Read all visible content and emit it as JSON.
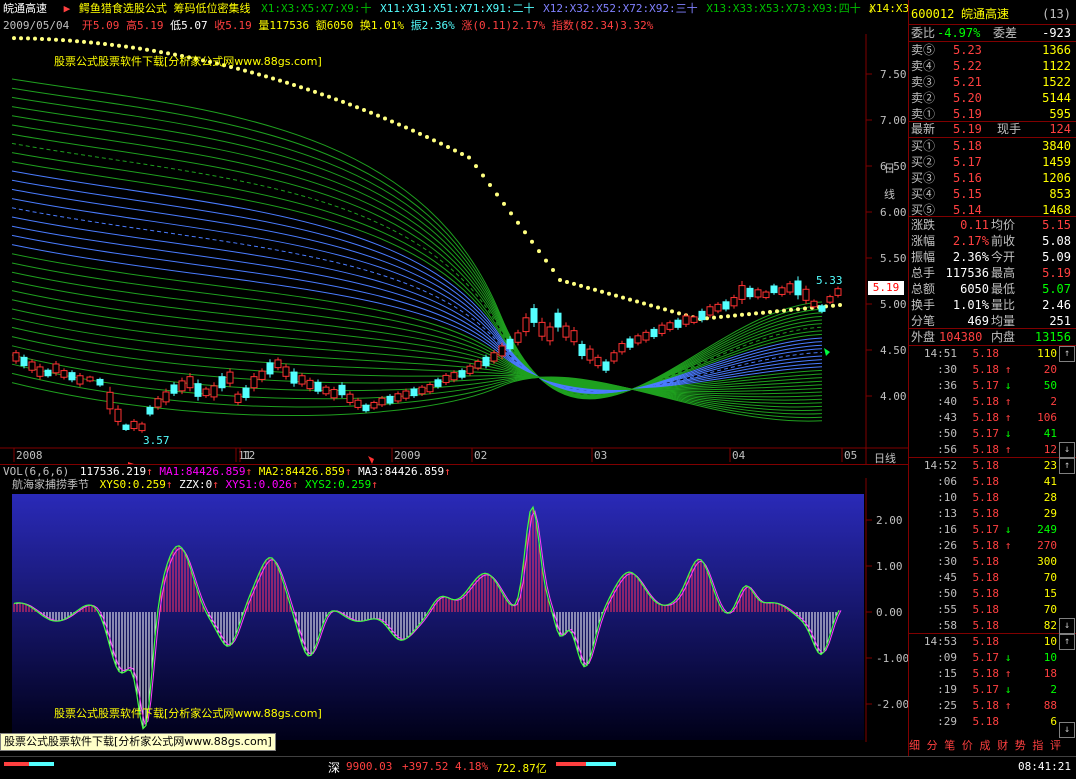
{
  "title_bar": {
    "stock_name": "皖通高速",
    "formula_label": "鳄鱼猎食选股公式 筹码低位密集线",
    "ma_labels": [
      "X1:X3:X5:X7:X9:十",
      "X11:X31:X51:X71:X91:二十",
      "X12:X32:X52:X72:X92:三十",
      "X13:X33:X53:X73:X93:四十",
      "X14:X3"
    ]
  },
  "quote_line": {
    "date": "2009/05/04",
    "open_label": "开",
    "open": "5.09",
    "high_label": "高",
    "high": "5.19",
    "low_label": "低",
    "low": "5.07",
    "close_label": "收",
    "close": "5.19",
    "vol_label": "量",
    "vol": "117536",
    "amount_label": "额",
    "amount": "6050",
    "turnover_label": "换",
    "turnover": "1.01%",
    "amplitude_label": "振",
    "amplitude": "2.36%",
    "change_label": "涨",
    "change": "(0.11)2.17%",
    "index_label": "指数",
    "index": "(82.34)3.32%"
  },
  "watermark_text": "股票公式股票软件下载[分析家公式网www.88gs.com]",
  "main_axis": {
    "ticks": [
      "7.50",
      "7.00",
      "6.50",
      "6.00",
      "5.50",
      "5.00",
      "4.50",
      "4.00"
    ],
    "current_price_tag": "5.19",
    "high_marker": "5.33",
    "low_marker": "3.57"
  },
  "date_axis": {
    "labels": [
      "2008",
      "11",
      "12",
      "2009",
      "02",
      "03",
      "04",
      "05"
    ],
    "period_button": "日线"
  },
  "side_tabs": [
    "日",
    "线"
  ],
  "vol_line": {
    "title": "VOL(6,6,6)",
    "vol": "117536.219",
    "ma1_label": "MA1:",
    "ma1": "84426.859",
    "ma2_label": "MA2:",
    "ma2": "84426.859",
    "ma3_label": "MA3:",
    "ma3": "84426.859"
  },
  "ind_line": {
    "title": "航海家捕捞季节",
    "xys0": "XYS0:0.259",
    "zzx": "ZZX:0",
    "xys1": "XYS1:0.026",
    "xys2": "XYS2:0.259"
  },
  "ind_axis": {
    "ticks": [
      "2.00",
      "1.00",
      "0.00",
      "-1.00",
      "-2.00"
    ]
  },
  "colors": {
    "bg": "#000000",
    "up": "#ff3232",
    "down": "#54ffff",
    "panel_line": "#800000",
    "ind_bg_top": "#2a2ab0",
    "ind_bg_bottom": "#000010",
    "green_line": "#00c000",
    "blue_line": "#4080ff",
    "sar_dot": "#ffff80"
  },
  "right_panel": {
    "code": "600012",
    "name": "皖通高速",
    "flag": "(13)",
    "weibi_label": "委比",
    "weibi": "-4.97%",
    "weicha_label": "委差",
    "weicha": "-923",
    "sells": [
      {
        "label": "卖⑤",
        "price": "5.23",
        "vol": "1366"
      },
      {
        "label": "卖④",
        "price": "5.22",
        "vol": "1122"
      },
      {
        "label": "卖③",
        "price": "5.21",
        "vol": "1522"
      },
      {
        "label": "卖②",
        "price": "5.20",
        "vol": "5144"
      },
      {
        "label": "卖①",
        "price": "5.19",
        "vol": "595"
      }
    ],
    "last_label": "最新",
    "last": "5.19",
    "xianshou_label": "现手",
    "xianshou": "124",
    "buys": [
      {
        "label": "买①",
        "price": "5.18",
        "vol": "3840"
      },
      {
        "label": "买②",
        "price": "5.17",
        "vol": "1459"
      },
      {
        "label": "买③",
        "price": "5.16",
        "vol": "1206"
      },
      {
        "label": "买④",
        "price": "5.15",
        "vol": "853"
      },
      {
        "label": "买⑤",
        "price": "5.14",
        "vol": "1468"
      }
    ],
    "stats": [
      {
        "l1": "涨跌",
        "v1": "0.11",
        "l2": "均价",
        "v2": "5.15"
      },
      {
        "l1": "涨幅",
        "v1": "2.17%",
        "l2": "前收",
        "v2": "5.08"
      },
      {
        "l1": "振幅",
        "v1": "2.36%",
        "l2": "今开",
        "v2": "5.09"
      },
      {
        "l1": "总手",
        "v1": "117536",
        "l2": "最高",
        "v2": "5.19"
      },
      {
        "l1": "总额",
        "v1": "6050",
        "l2": "最低",
        "v2": "5.07"
      },
      {
        "l1": "换手",
        "v1": "1.01%",
        "l2": "量比",
        "v2": "2.46"
      },
      {
        "l1": "分笔",
        "v1": "469",
        "l2": "均量",
        "v2": "251"
      }
    ],
    "outer_label": "外盘",
    "outer": "104380",
    "inner_label": "内盘",
    "inner": "13156",
    "ticks_block1": [
      {
        "t": "14:51",
        "p": "5.18",
        "d": "",
        "v": "110"
      },
      {
        "t": ":30",
        "p": "5.18",
        "d": "↑",
        "v": "20"
      },
      {
        "t": ":36",
        "p": "5.17",
        "d": "↓",
        "v": "50"
      },
      {
        "t": ":40",
        "p": "5.18",
        "d": "↑",
        "v": "2"
      },
      {
        "t": ":43",
        "p": "5.18",
        "d": "↑",
        "v": "106"
      },
      {
        "t": ":50",
        "p": "5.17",
        "d": "↓",
        "v": "41"
      },
      {
        "t": ":56",
        "p": "5.18",
        "d": "↑",
        "v": "12"
      }
    ],
    "ticks_block2": [
      {
        "t": "14:52",
        "p": "5.18",
        "d": "",
        "v": "23"
      },
      {
        "t": ":06",
        "p": "5.18",
        "d": "",
        "v": "41"
      },
      {
        "t": ":10",
        "p": "5.18",
        "d": "",
        "v": "28"
      },
      {
        "t": ":13",
        "p": "5.18",
        "d": "",
        "v": "29"
      },
      {
        "t": ":16",
        "p": "5.17",
        "d": "↓",
        "v": "249"
      },
      {
        "t": ":26",
        "p": "5.18",
        "d": "↑",
        "v": "270"
      },
      {
        "t": ":30",
        "p": "5.18",
        "d": "",
        "v": "300"
      },
      {
        "t": ":45",
        "p": "5.18",
        "d": "",
        "v": "70"
      },
      {
        "t": ":50",
        "p": "5.18",
        "d": "",
        "v": "15"
      },
      {
        "t": ":55",
        "p": "5.18",
        "d": "",
        "v": "70"
      },
      {
        "t": ":58",
        "p": "5.18",
        "d": "",
        "v": "82"
      }
    ],
    "ticks_block3": [
      {
        "t": "14:53",
        "p": "5.18",
        "d": "",
        "v": "10"
      },
      {
        "t": ":09",
        "p": "5.17",
        "d": "↓",
        "v": "10"
      },
      {
        "t": ":15",
        "p": "5.18",
        "d": "↑",
        "v": "18"
      },
      {
        "t": ":19",
        "p": "5.17",
        "d": "↓",
        "v": "2"
      },
      {
        "t": ":25",
        "p": "5.18",
        "d": "↑",
        "v": "88"
      },
      {
        "t": ":29",
        "p": "5.18",
        "d": "",
        "v": "6"
      }
    ],
    "bottom_tabs": "细 分 笔 价 成 财 势 指 评"
  },
  "status_bar": {
    "market": "深",
    "index": "9900.03",
    "change": "+397.52",
    "pct": "4.18%",
    "amount": "722.87亿",
    "time": "08:41:21"
  }
}
